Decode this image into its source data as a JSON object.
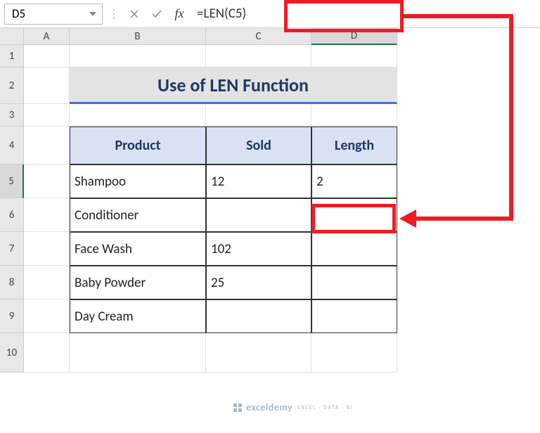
{
  "namebox": "D5",
  "formula": "=LEN(C5)",
  "columns": {
    "A": "A",
    "B": "B",
    "C": "C",
    "D": "D"
  },
  "rows": {
    "1": "1",
    "2": "2",
    "3": "3",
    "4": "4",
    "5": "5",
    "6": "6",
    "7": "7",
    "8": "8",
    "9": "9",
    "10": "10"
  },
  "title": "Use of LEN Function",
  "headers": {
    "product": "Product",
    "sold": "Sold",
    "length": "Length"
  },
  "chart_data": {
    "type": "table",
    "columns": [
      "Product",
      "Sold",
      "Length"
    ],
    "rows": [
      {
        "product": "Shampoo",
        "sold": "12",
        "length": "2"
      },
      {
        "product": "Conditioner",
        "sold": "",
        "length": ""
      },
      {
        "product": "Face Wash",
        "sold": "102",
        "length": ""
      },
      {
        "product": "Baby Powder",
        "sold": "25",
        "length": ""
      },
      {
        "product": "Day Cream",
        "sold": "",
        "length": ""
      }
    ]
  },
  "watermark": {
    "brand": "exceldemy",
    "sub": "EXCEL · DATA · BI"
  }
}
